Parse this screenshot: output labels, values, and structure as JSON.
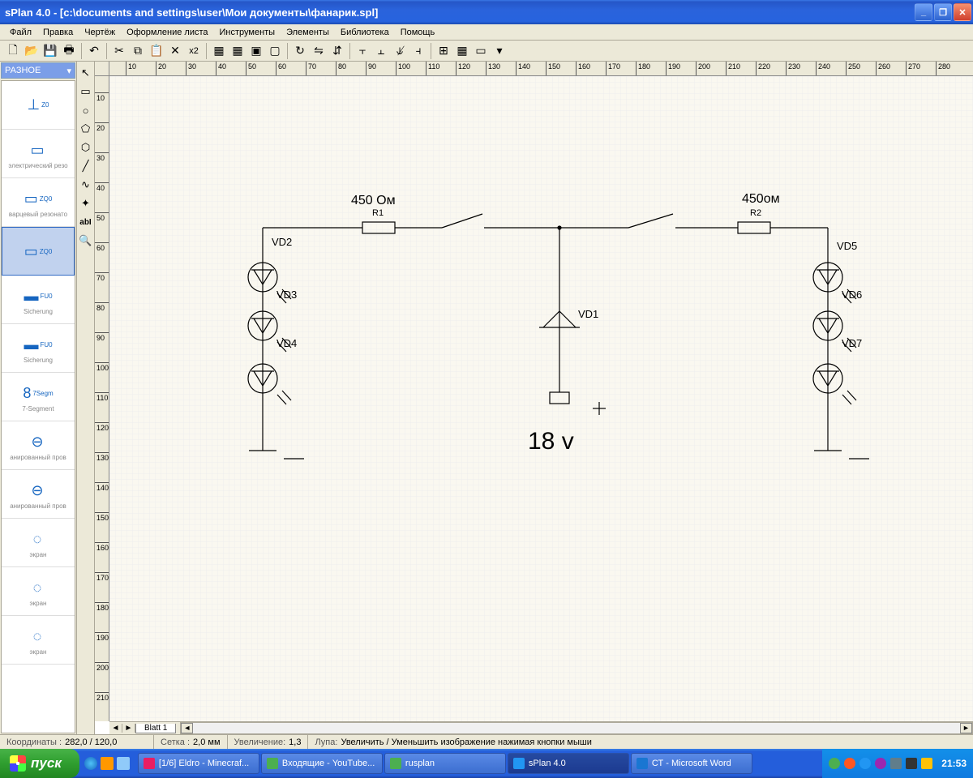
{
  "title": "sPlan 4.0 - [c:\\documents and settings\\user\\Мои документы\\фанарик.spl]",
  "menu": [
    "Файл",
    "Правка",
    "Чертёж",
    "Оформление листа",
    "Инструменты",
    "Элементы",
    "Библиотека",
    "Помощь"
  ],
  "toolbar_x2": "x2",
  "sidebar": {
    "category": "РАЗНОЕ",
    "items": [
      {
        "lbl": "Z0",
        "sub": ""
      },
      {
        "lbl": "",
        "sub": "электрический резо"
      },
      {
        "lbl": "ZQ0",
        "sub": "варцевый резонато"
      },
      {
        "lbl": "ZQ0",
        "sub": "",
        "sel": true
      },
      {
        "lbl": "FU0",
        "sub": "Sicherung"
      },
      {
        "lbl": "FU0",
        "sub": "Sicherung"
      },
      {
        "lbl": "7Segm",
        "sub": "7-Segment"
      },
      {
        "lbl": "",
        "sub": "анированный пров"
      },
      {
        "lbl": "",
        "sub": "анированный пров"
      },
      {
        "lbl": "",
        "sub": "экран"
      },
      {
        "lbl": "",
        "sub": "экран"
      },
      {
        "lbl": "",
        "sub": "экран"
      }
    ]
  },
  "ruler_h": [
    10,
    20,
    30,
    40,
    50,
    60,
    70,
    80,
    90,
    100,
    110,
    120,
    130,
    140,
    150,
    160,
    170,
    180,
    190,
    200,
    210,
    220,
    230,
    240,
    250,
    260,
    270,
    280
  ],
  "ruler_v": [
    10,
    20,
    30,
    40,
    50,
    60,
    70,
    80,
    90,
    100,
    110,
    120,
    130,
    140,
    150,
    160,
    170,
    180,
    190,
    200,
    210
  ],
  "schematic": {
    "r1_val": "450 Ом",
    "r1": "R1",
    "r2_val": "450ом",
    "r2": "R2",
    "vd1": "VD1",
    "vd2": "VD2",
    "vd3": "VD3",
    "vd4": "VD4",
    "vd5": "VD5",
    "vd6": "VD6",
    "vd7": "VD7",
    "voltage": "18 v"
  },
  "sheet_tab": "Blatt 1",
  "status": {
    "coord_lbl": "Координаты :",
    "coord": "282,0 / 120,0",
    "grid_lbl": "Сетка :",
    "grid": "2,0 мм",
    "zoom_lbl": "Увеличение:",
    "zoom": "1,3",
    "loupe_lbl": "Лупа:",
    "loupe": "Увеличить / Уменьшить изображение нажимая кнопки мыши"
  },
  "taskbar": {
    "start": "пуск",
    "tasks": [
      {
        "t": "[1/6] Eldro - Minecraf...",
        "c": "#e91e63"
      },
      {
        "t": "Входящие - YouTube...",
        "c": "#4caf50"
      },
      {
        "t": "rusplan",
        "c": "#4caf50"
      },
      {
        "t": "sPlan 4.0",
        "c": "#2196f3",
        "active": true
      },
      {
        "t": "СТ - Microsoft Word",
        "c": "#1976d2"
      }
    ],
    "clock": "21:53"
  }
}
